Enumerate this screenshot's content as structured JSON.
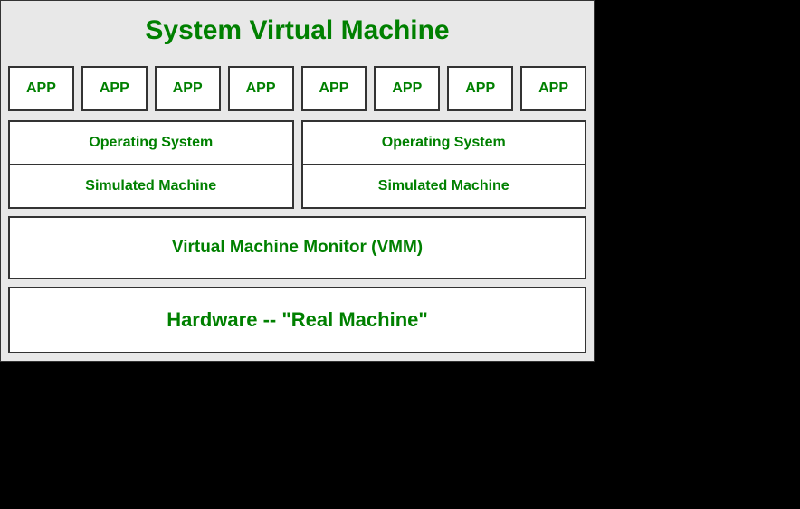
{
  "title": "System Virtual Machine",
  "app_label": "APP",
  "os_label": "Operating System",
  "sim_label": "Simulated Machine",
  "vmm_label": "Virtual Machine Monitor (VMM)",
  "hardware_label": "Hardware -- \"Real Machine\""
}
